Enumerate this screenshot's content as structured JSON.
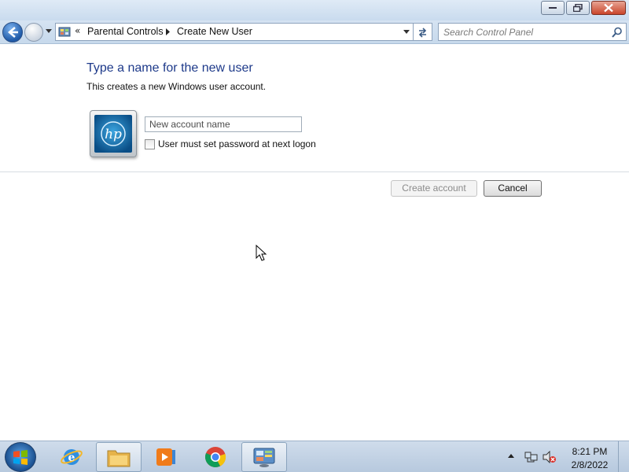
{
  "window": {
    "breadcrumb": [
      "Parental Controls",
      "Create New User"
    ],
    "breadcrumb_chevron": "«",
    "search": {
      "placeholder": "Search Control Panel"
    }
  },
  "page": {
    "heading": "Type a name for the new user",
    "subtext": "This creates a new Windows user account.",
    "avatar_text": "hp",
    "name_input": {
      "placeholder": "New account name",
      "value": ""
    },
    "password_checkbox": {
      "label": "User must set password at next logon",
      "checked": false
    },
    "create_button": "Create account",
    "cancel_button": "Cancel"
  },
  "taskbar": {
    "items": [
      "start",
      "internet-explorer",
      "file-explorer",
      "media-player",
      "chrome",
      "control-panel"
    ],
    "active_item": "control-panel",
    "clock_time": "8:21 PM",
    "clock_date": "2/8/2022"
  },
  "colors": {
    "heading": "#1e3a8a",
    "accent": "#1f5aa8"
  }
}
